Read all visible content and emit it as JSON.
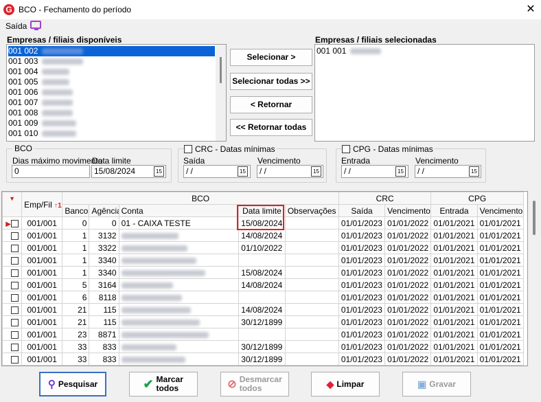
{
  "window": {
    "title": "BCO - Fechamento do período",
    "close_glyph": "✕",
    "app_icon_letter": "G"
  },
  "menu": {
    "saida": "Saída",
    "monitor_icon": "monitor-icon"
  },
  "available": {
    "label": "Empresas / filiais disponíveis",
    "items": [
      "001 002",
      "001 003",
      "001 004",
      "001 005",
      "001 006",
      "001 007",
      "001 008",
      "001 009",
      "001 010"
    ]
  },
  "selected_list": {
    "label": "Empresas / filiais selecionadas",
    "items": [
      "001 001"
    ]
  },
  "transfer_buttons": {
    "select": "Selecionar >",
    "select_all": "Selecionar todas >>",
    "return": "< Retornar",
    "return_all": "<< Retornar todas"
  },
  "bco_group": {
    "label": "BCO",
    "dias_label": "Dias máximo movimento",
    "dias_value": "0",
    "data_label": "Data limite",
    "data_value": "15/08/2024"
  },
  "crc_group": {
    "label": "CRC - Datas mínimas",
    "saida_label": "Saída",
    "saida_value": " / /",
    "venc_label": "Vencimento",
    "venc_value": " / /"
  },
  "cpg_group": {
    "label": "CPG - Datas mínimas",
    "entrada_label": "Entrada",
    "entrada_value": " / /",
    "venc_label": "Vencimento",
    "venc_value": " / /"
  },
  "calendar_glyph": "15",
  "grid": {
    "group_headers": {
      "bco": "BCO",
      "crc": "CRC",
      "cpg": "CPG"
    },
    "columns": {
      "empfil": "Emp/Fil",
      "sort_mark": "1",
      "banco": "Banco",
      "agencia": "Agência",
      "conta": "Conta",
      "data_limite": "Data limite",
      "obs": "Observações",
      "crc_saida": "Saída",
      "crc_venc": "Vencimento",
      "cpg_entrada": "Entrada",
      "cpg_venc": "Vencimento"
    },
    "rows": [
      {
        "empfil": "001/001",
        "banco": "0",
        "agencia": "0",
        "conta": "01 - CAIXA TESTE",
        "data_limite": "15/08/2024",
        "crc_saida": "01/01/2023",
        "crc_venc": "01/01/2022",
        "cpg_entrada": "01/01/2021",
        "cpg_venc": "01/01/2021"
      },
      {
        "empfil": "001/001",
        "banco": "1",
        "agencia": "3132",
        "conta": "",
        "data_limite": "14/08/2024",
        "crc_saida": "01/01/2023",
        "crc_venc": "01/01/2022",
        "cpg_entrada": "01/01/2021",
        "cpg_venc": "01/01/2021"
      },
      {
        "empfil": "001/001",
        "banco": "1",
        "agencia": "3322",
        "conta": "",
        "data_limite": "01/10/2022",
        "crc_saida": "01/01/2023",
        "crc_venc": "01/01/2022",
        "cpg_entrada": "01/01/2021",
        "cpg_venc": "01/01/2021"
      },
      {
        "empfil": "001/001",
        "banco": "1",
        "agencia": "3340",
        "conta": "",
        "data_limite": "",
        "crc_saida": "01/01/2023",
        "crc_venc": "01/01/2022",
        "cpg_entrada": "01/01/2021",
        "cpg_venc": "01/01/2021"
      },
      {
        "empfil": "001/001",
        "banco": "1",
        "agencia": "3340",
        "conta": "",
        "data_limite": "15/08/2024",
        "crc_saida": "01/01/2023",
        "crc_venc": "01/01/2022",
        "cpg_entrada": "01/01/2021",
        "cpg_venc": "01/01/2021"
      },
      {
        "empfil": "001/001",
        "banco": "5",
        "agencia": "3164",
        "conta": "",
        "data_limite": "14/08/2024",
        "crc_saida": "01/01/2023",
        "crc_venc": "01/01/2022",
        "cpg_entrada": "01/01/2021",
        "cpg_venc": "01/01/2021"
      },
      {
        "empfil": "001/001",
        "banco": "6",
        "agencia": "8118",
        "conta": "",
        "data_limite": "",
        "crc_saida": "01/01/2023",
        "crc_venc": "01/01/2022",
        "cpg_entrada": "01/01/2021",
        "cpg_venc": "01/01/2021"
      },
      {
        "empfil": "001/001",
        "banco": "21",
        "agencia": "115",
        "conta": "",
        "data_limite": "14/08/2024",
        "crc_saida": "01/01/2023",
        "crc_venc": "01/01/2022",
        "cpg_entrada": "01/01/2021",
        "cpg_venc": "01/01/2021"
      },
      {
        "empfil": "001/001",
        "banco": "21",
        "agencia": "115",
        "conta": "",
        "data_limite": "30/12/1899",
        "crc_saida": "01/01/2023",
        "crc_venc": "01/01/2022",
        "cpg_entrada": "01/01/2021",
        "cpg_venc": "01/01/2021"
      },
      {
        "empfil": "001/001",
        "banco": "23",
        "agencia": "8871",
        "conta": "",
        "data_limite": "",
        "crc_saida": "01/01/2023",
        "crc_venc": "01/01/2022",
        "cpg_entrada": "01/01/2021",
        "cpg_venc": "01/01/2021"
      },
      {
        "empfil": "001/001",
        "banco": "33",
        "agencia": "833",
        "conta": "",
        "data_limite": "30/12/1899",
        "crc_saida": "01/01/2023",
        "crc_venc": "01/01/2022",
        "cpg_entrada": "01/01/2021",
        "cpg_venc": "01/01/2021"
      },
      {
        "empfil": "001/001",
        "banco": "33",
        "agencia": "833",
        "conta": "",
        "data_limite": "30/12/1899",
        "crc_saida": "01/01/2023",
        "crc_venc": "01/01/2022",
        "cpg_entrada": "01/01/2021",
        "cpg_venc": "01/01/2021"
      }
    ]
  },
  "bottom_buttons": {
    "pesquisar": "Pesquisar",
    "marcar": "Marcar todos",
    "desmarcar": "Desmarcar todos",
    "limpar": "Limpar",
    "gravar": "Gravar"
  },
  "colors": {
    "accent_selection": "#0a64d8",
    "highlight_box": "#e02020",
    "icon_purple": "#a23fd1"
  }
}
